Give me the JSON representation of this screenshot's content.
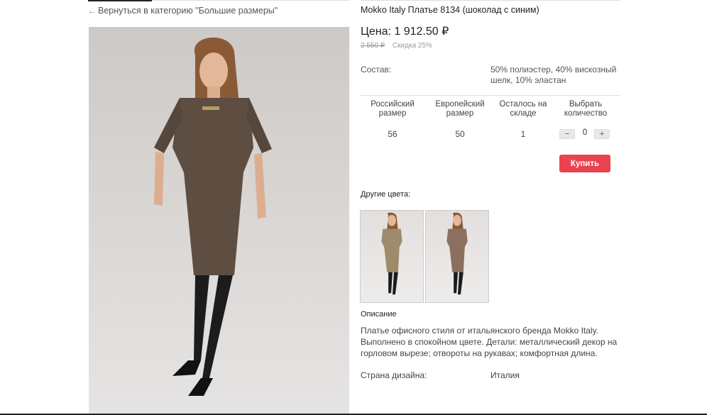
{
  "nav": {
    "back_arrow": "←",
    "back_label": "Вернуться в категорию \"Большие размеры\""
  },
  "product": {
    "title": "Mokko Italy Платье 8134 (шоколад с синим)",
    "price_label": "Цена:",
    "price": "1 912.50",
    "currency": "₽",
    "old_price": "2 550 ₽",
    "discount": "Скидка 25%"
  },
  "composition": {
    "label": "Состав:",
    "value": "50% полиэстер, 40% вискозный шелк, 10% эластан"
  },
  "size_table": {
    "headers": {
      "ru_size": "Российский размер",
      "eu_size": "Европейский размер",
      "stock": "Осталось на складе",
      "qty": "Выбрать количество"
    },
    "row": {
      "ru_size": "56",
      "eu_size": "50",
      "stock": "1",
      "qty_value": "0"
    },
    "minus": "−",
    "plus": "+"
  },
  "buy_button": "Купить",
  "other_colors": {
    "label": "Другие цвета:",
    "swatches": [
      {
        "dress_color": "#a08a6c"
      },
      {
        "dress_color": "#8b6f60"
      }
    ]
  },
  "description": {
    "heading": "Описание",
    "text": "Платье офисного стиля от итальянского бренда Mokko Italy. Выполнено в спокойном цвете. Детали: металлический декор на горловом вырезе; отвороты на рукавах; комфортная длина."
  },
  "country": {
    "label": "Страна дизайна:",
    "value": "Италия"
  },
  "colors": {
    "accent": "#e8434f",
    "main_dress": "#5e4e42"
  }
}
